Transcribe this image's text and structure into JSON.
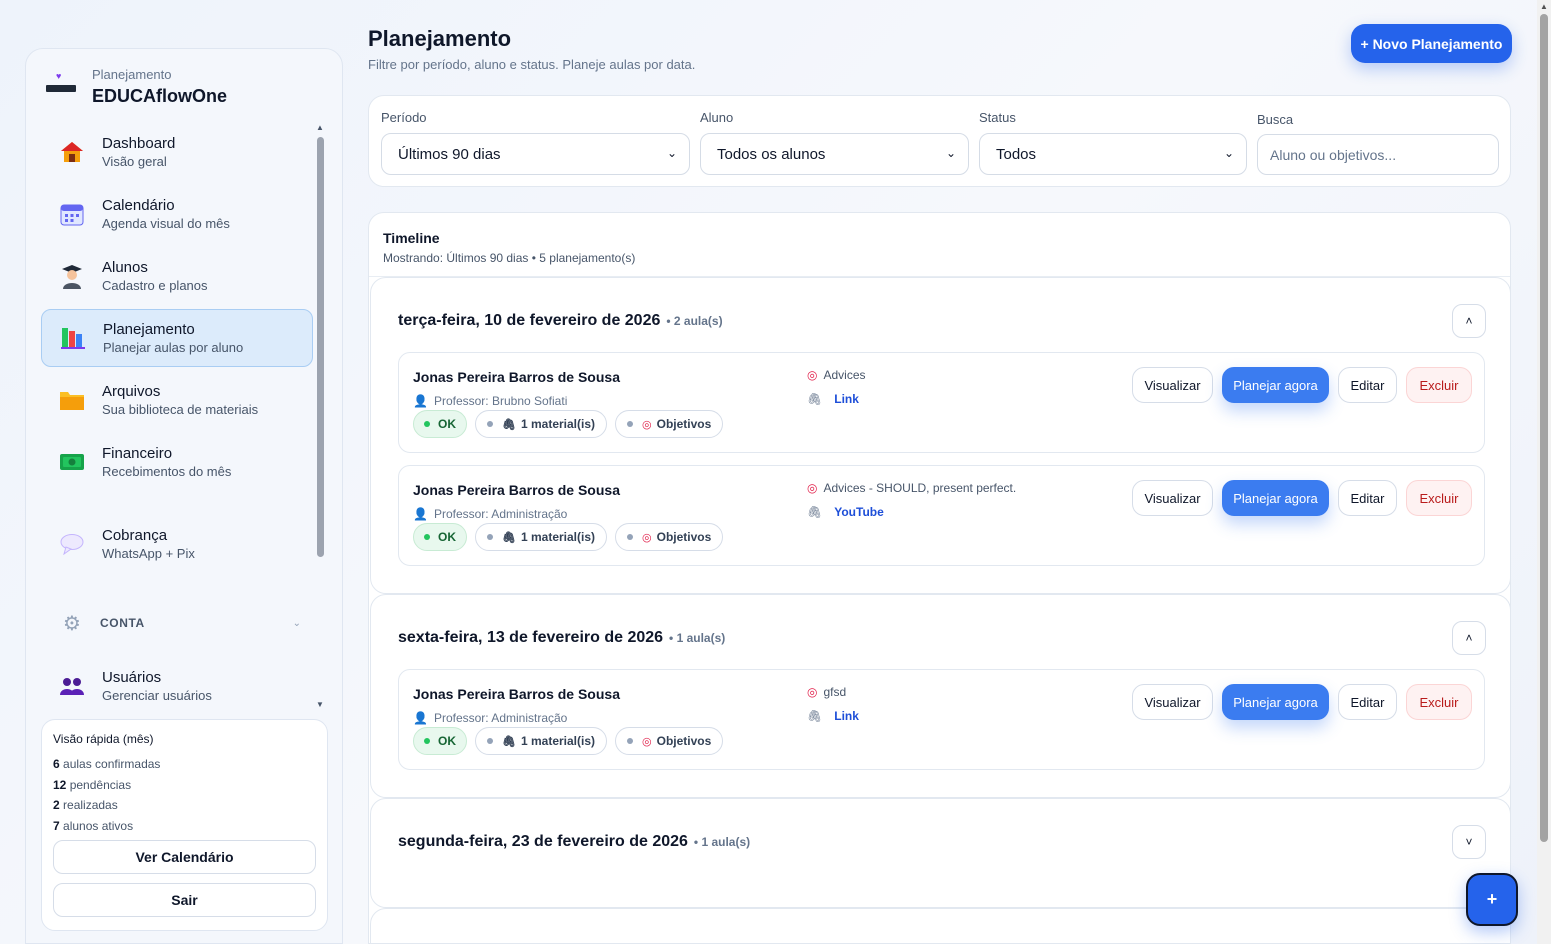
{
  "brand": {
    "subtitle": "Planejamento",
    "name": "EDUCAflowOne"
  },
  "nav": {
    "items": [
      {
        "label": "Dashboard",
        "desc": "Visão geral",
        "icon": "house-icon"
      },
      {
        "label": "Calendário",
        "desc": "Agenda visual do mês",
        "icon": "calendar-icon"
      },
      {
        "label": "Alunos",
        "desc": "Cadastro e planos",
        "icon": "student-icon"
      },
      {
        "label": "Planejamento",
        "desc": "Planejar aulas por aluno",
        "icon": "books-icon",
        "active": true
      },
      {
        "label": "Arquivos",
        "desc": "Sua biblioteca de materiais",
        "icon": "folder-icon"
      },
      {
        "label": "Financeiro",
        "desc": "Recebimentos do mês",
        "icon": "money-icon"
      },
      {
        "label": "Cobrança",
        "desc": "WhatsApp + Pix",
        "icon": "speech-bubble-icon"
      }
    ],
    "section": {
      "label": "CONTA",
      "icon": "gear-icon"
    },
    "account_items": [
      {
        "label": "Usuários",
        "desc": "Gerenciar usuários",
        "icon": "users-icon"
      }
    ]
  },
  "quick": {
    "title": "Visão rápida (mês)",
    "stats": [
      {
        "value": "6",
        "label": "aulas confirmadas"
      },
      {
        "value": "12",
        "label": "pendências"
      },
      {
        "value": "2",
        "label": "realizadas"
      },
      {
        "value": "7",
        "label": "alunos ativos"
      }
    ],
    "calendar_button": "Ver Calendário",
    "logout_button": "Sair"
  },
  "header": {
    "title": "Planejamento",
    "subtitle": "Filtre por período, aluno e status. Planeje aulas por data.",
    "new_button": "+ Novo Planejamento"
  },
  "filters": {
    "period": {
      "label": "Período",
      "value": "Últimos 90 dias"
    },
    "student": {
      "label": "Aluno",
      "value": "Todos os alunos"
    },
    "status": {
      "label": "Status",
      "value": "Todos"
    },
    "search": {
      "label": "Busca",
      "placeholder": "Aluno ou objetivos..."
    }
  },
  "timeline": {
    "title": "Timeline",
    "subtitle": "Mostrando: Últimos 90 dias • 5 planejamento(s)",
    "days": [
      {
        "title": "terça-feira, 10 de fevereiro de 2026",
        "count": "• 2 aula(s)",
        "toggle": "˄",
        "entries": [
          {
            "student": "Jonas Pereira Barros de Sousa",
            "professor": "Professor: Brubno Sofiati",
            "status": "OK",
            "materials": "1 material(is)",
            "objectives_chip": "Objetivos",
            "objective": "Advices",
            "link": "Link"
          },
          {
            "student": "Jonas Pereira Barros de Sousa",
            "professor": "Professor: Administração",
            "status": "OK",
            "materials": "1 material(is)",
            "objectives_chip": "Objetivos",
            "objective": "Advices - SHOULD, present perfect.",
            "link": "YouTube"
          }
        ]
      },
      {
        "title": "sexta-feira, 13 de fevereiro de 2026",
        "count": "• 1 aula(s)",
        "toggle": "˄",
        "entries": [
          {
            "student": "Jonas Pereira Barros de Sousa",
            "professor": "Professor: Administração",
            "status": "OK",
            "materials": "1 material(is)",
            "objectives_chip": "Objetivos",
            "objective": "gfsd",
            "link": "Link"
          }
        ]
      },
      {
        "title": "segunda-feira, 23 de fevereiro de 2026",
        "count": "• 1 aula(s)",
        "toggle": "˅",
        "entries": []
      }
    ],
    "actions": {
      "view": "Visualizar",
      "plan": "Planejar agora",
      "edit": "Editar",
      "delete": "Excluir"
    }
  },
  "fab": {
    "label": "+"
  },
  "colors": {
    "primary": "#2563eb",
    "active_bg": "#dcebfb",
    "ok": "#22c55e",
    "danger": "#b91c1c"
  }
}
